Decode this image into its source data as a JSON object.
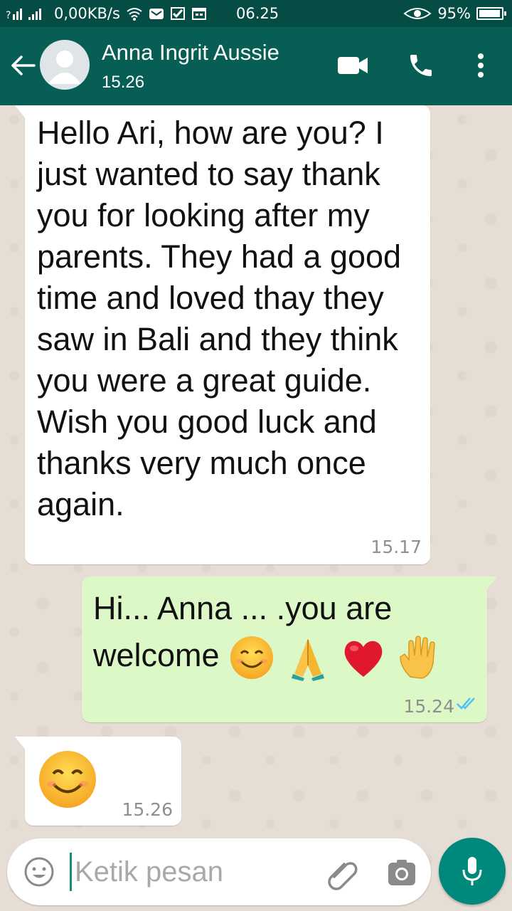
{
  "status_bar": {
    "data_rate": "0,00KB/s",
    "time": "06.25",
    "battery": "95%",
    "battery_level": 0.95
  },
  "header": {
    "contact_name": "Anna Ingrit Aussie",
    "last_seen": "15.26",
    "icons": [
      "back-arrow-icon",
      "avatar-placeholder",
      "video-call-icon",
      "phone-icon",
      "more-vert-icon"
    ]
  },
  "messages": [
    {
      "direction": "incoming",
      "text": "Hello Ari,  how are you? I just wanted to say thank you for looking after my parents.  They had a good time and loved thay they saw in Bali and they think you were a great guide.  Wish you good luck and thanks very much once again.",
      "time": "15.17"
    },
    {
      "direction": "outgoing",
      "text_line1": "Hi...  Anna ... .you are",
      "text_line2": "welcome",
      "emojis": [
        "smiling-face-icon",
        "folded-hands-icon",
        "red-heart-icon",
        "raised-hand-icon"
      ],
      "time": "15.24",
      "status": "read-double-tick-icon"
    },
    {
      "direction": "incoming",
      "emojis": [
        "smiling-face-icon"
      ],
      "time": "15.26"
    }
  ],
  "composer": {
    "placeholder": "Ketik pesan",
    "value": ""
  },
  "colors": {
    "header": "#075e54",
    "status_bar": "#054d44",
    "outgoing_bubble": "#dcf8c6",
    "incoming_bubble": "#ffffff",
    "fab": "#00897b",
    "read_tick": "#4fc3f7"
  }
}
